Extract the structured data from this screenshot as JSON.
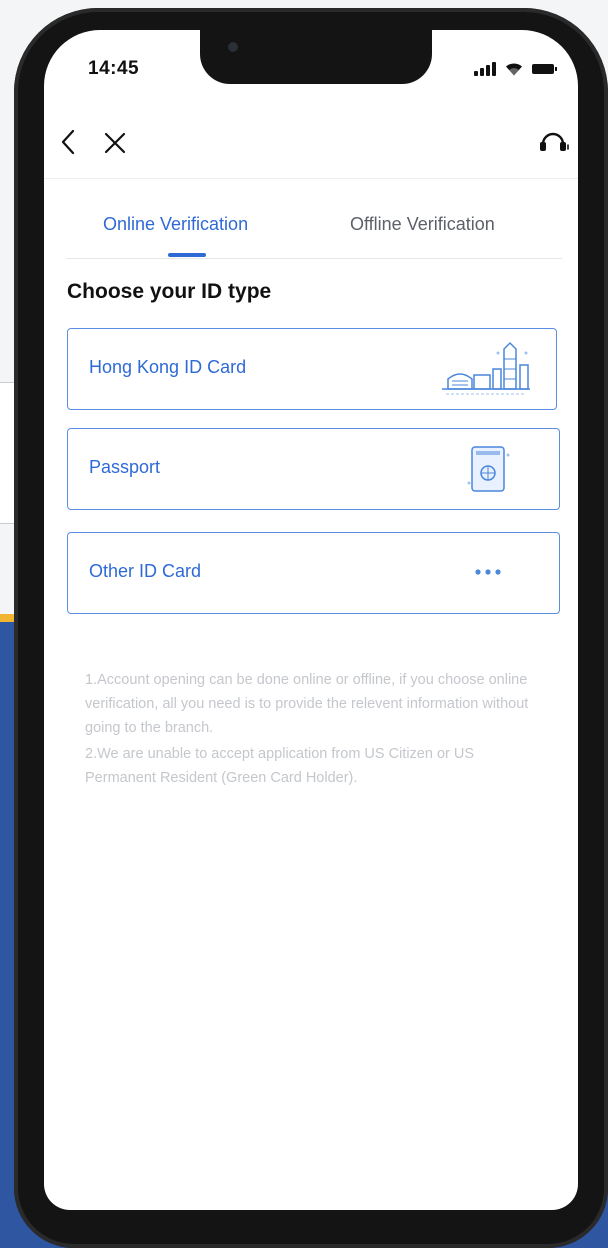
{
  "status_bar": {
    "time": "14:45"
  },
  "nav": {
    "back_icon": "chevron-left-icon",
    "close_icon": "close-icon",
    "support_icon": "headset-icon"
  },
  "tabs": [
    {
      "label": "Online Verification",
      "active": true
    },
    {
      "label": "Offline Verification",
      "active": false
    }
  ],
  "section_title": "Choose your ID type",
  "id_options": [
    {
      "label": "Hong Kong ID Card",
      "icon": "hong-kong-skyline-icon"
    },
    {
      "label": "Passport",
      "icon": "passport-icon"
    },
    {
      "label": "Other ID Card",
      "icon": "more-dots-icon"
    }
  ],
  "notes": [
    "1.Account opening can be done online or offline, if you choose online verification, all you need is to provide the relevent information without going to the branch.",
    "2.We are unable to accept application from US Citizen or US Permanent Resident (Green Card Holder)."
  ],
  "colors": {
    "accent": "#2e6ad6",
    "card_border": "#5b8ee0",
    "note_text": "#c4c7cc",
    "background_blue": "#2f56a0",
    "background_stripe": "#f2b531"
  }
}
